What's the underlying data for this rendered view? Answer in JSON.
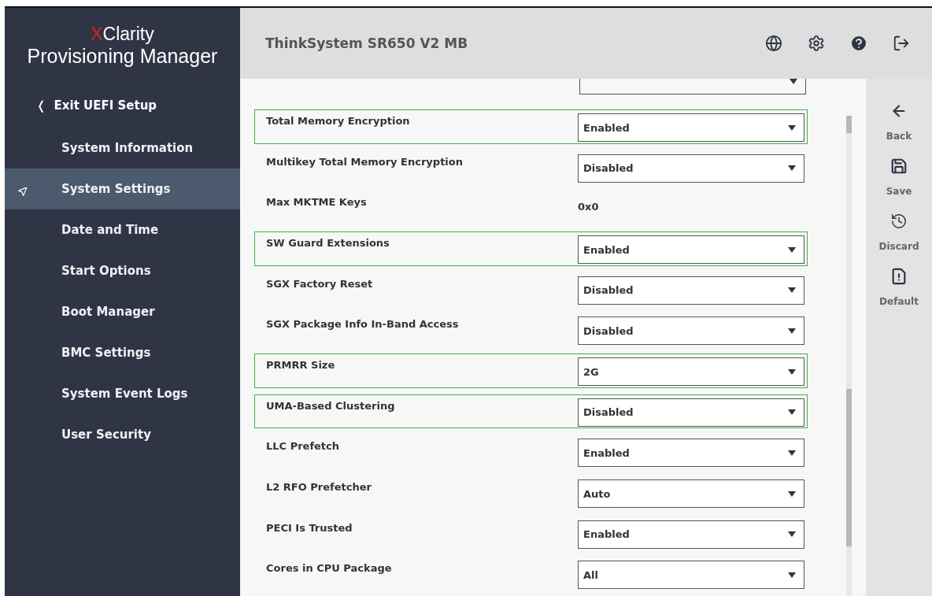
{
  "logo": {
    "mark": "X",
    "word": "Clarity",
    "product": "Provisioning Manager"
  },
  "header": {
    "title": "ThinkSystem SR650 V2 MB"
  },
  "sidebar": {
    "exit": {
      "chevron": "❬",
      "label": "Exit UEFI Setup"
    },
    "items": [
      {
        "label": "System Information",
        "selected": false
      },
      {
        "label": "System Settings",
        "selected": true
      },
      {
        "label": "Date and Time",
        "selected": false
      },
      {
        "label": "Start Options",
        "selected": false
      },
      {
        "label": "Boot Manager",
        "selected": false
      },
      {
        "label": "BMC Settings",
        "selected": false
      },
      {
        "label": "System Event Logs",
        "selected": false
      },
      {
        "label": "User Security",
        "selected": false
      }
    ]
  },
  "settings": [
    {
      "label": "Total Memory Encryption",
      "kind": "select",
      "value": "Enabled",
      "highlighted": true
    },
    {
      "label": "Multikey Total Memory Encryption",
      "kind": "select",
      "value": "Disabled",
      "highlighted": false
    },
    {
      "label": "Max MKTME Keys",
      "kind": "text",
      "value": "0x0",
      "highlighted": false
    },
    {
      "label": "SW Guard Extensions",
      "kind": "select",
      "value": "Enabled",
      "highlighted": true
    },
    {
      "label": "SGX Factory Reset",
      "kind": "select",
      "value": "Disabled",
      "highlighted": false
    },
    {
      "label": "SGX Package Info In-Band Access",
      "kind": "select",
      "value": "Disabled",
      "highlighted": false
    },
    {
      "label": "PRMRR Size",
      "kind": "select",
      "value": "2G",
      "highlighted": true
    },
    {
      "label": "UMA-Based Clustering",
      "kind": "select",
      "value": "Disabled",
      "highlighted": true
    },
    {
      "label": "LLC Prefetch",
      "kind": "select",
      "value": "Enabled",
      "highlighted": false
    },
    {
      "label": "L2 RFO Prefetcher",
      "kind": "select",
      "value": "Auto",
      "highlighted": false
    },
    {
      "label": "PECI Is Trusted",
      "kind": "select",
      "value": "Enabled",
      "highlighted": false
    },
    {
      "label": "Cores in CPU Package",
      "kind": "select",
      "value": "All",
      "highlighted": false
    }
  ],
  "actions": [
    {
      "kind": "back",
      "label": "Back"
    },
    {
      "kind": "save",
      "label": "Save"
    },
    {
      "kind": "discard",
      "label": "Discard"
    },
    {
      "kind": "default",
      "label": "Default"
    }
  ]
}
